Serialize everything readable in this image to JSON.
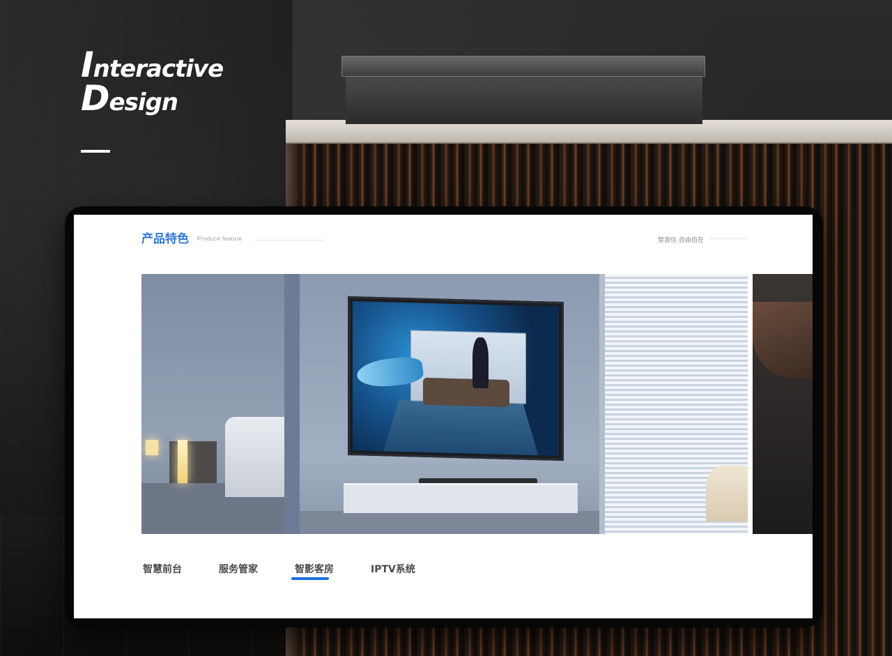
{
  "heading": {
    "line1_cap": "I",
    "line1_rest": "nteractive",
    "line2_cap": "D",
    "line2_rest": "esign"
  },
  "screen": {
    "section_title": "产品特色",
    "section_subtitle": "Produce feature",
    "slogan": "智游住·自由自在",
    "banner_image": "smart-hotel-room-with-3d-tv",
    "tabs": [
      {
        "label": "智慧前台",
        "active": false
      },
      {
        "label": "服务管家",
        "active": false
      },
      {
        "label": "智影客房",
        "active": true
      },
      {
        "label": "IPTV系统",
        "active": false
      }
    ]
  },
  "colors": {
    "accent": "#1c6fe0",
    "title_blue": "#2f7ad8",
    "background": "#1b1b1c"
  }
}
